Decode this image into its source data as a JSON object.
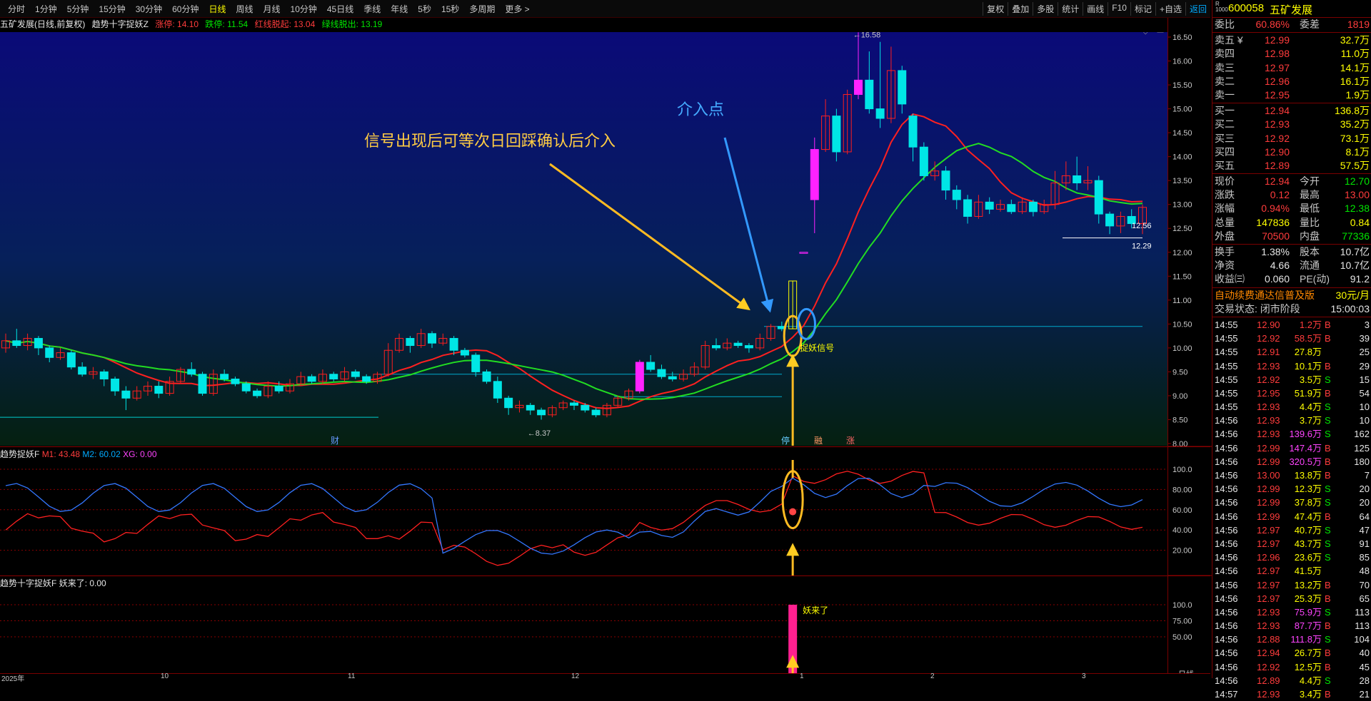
{
  "toolbar": {
    "periods": [
      "分时",
      "1分钟",
      "5分钟",
      "15分钟",
      "30分钟",
      "60分钟",
      "日线",
      "周线",
      "月线",
      "10分钟",
      "45日线",
      "季线",
      "年线",
      "5秒",
      "15秒",
      "多周期",
      "更多 >"
    ],
    "active_period": "日线",
    "right_tools": [
      "复权",
      "叠加",
      "多股",
      "统计",
      "画线",
      "F10",
      "标记",
      "+自选",
      "返回"
    ]
  },
  "main_header": {
    "stock": "五矿发展(日线,前复权)",
    "indicator": "趋势十字捉妖Z",
    "zt_label": "涨停: 14.10",
    "dt_label": "跌停: 11.54",
    "red_label": "红线脱起: 13.04",
    "green_label": "绿线脱出: 13.19"
  },
  "annotations": {
    "text1": "信号出现后可等次日回踩确认后介入",
    "text2": "介入点",
    "signal_label": "捉妖信号",
    "low_label": "←8.37",
    "high_label": "←16.58",
    "price_1256": "12.56",
    "price_1229": "12.29",
    "marker_cai": "财",
    "marker_ting": "停",
    "marker_rong": "融",
    "marker_zhang": "涨",
    "yao_label": "妖来了"
  },
  "main_axis": [
    "16.50",
    "16.00",
    "15.50",
    "15.00",
    "14.50",
    "14.00",
    "13.50",
    "13.00",
    "12.50",
    "12.00",
    "11.50",
    "11.00",
    "10.50",
    "10.00",
    "9.50",
    "9.00",
    "8.50",
    "8.00"
  ],
  "pane2": {
    "name": "趋势捉妖F",
    "m1": "M1: 43.48",
    "m2": "M2: 60.02",
    "xg": "XG: 0.00",
    "axis": [
      "100.0",
      "80.00",
      "60.00",
      "40.00",
      "20.00"
    ]
  },
  "pane3": {
    "name": "趋势十字捉妖F",
    "value": "妖来了: 0.00",
    "axis": [
      "100.0",
      "75.00",
      "50.00"
    ]
  },
  "time_axis": [
    "2025年",
    "10",
    "11",
    "12",
    "1",
    "2",
    "3"
  ],
  "quote": {
    "code": "600058",
    "name": "五矿发展",
    "ratio_label": "委比",
    "ratio": "60.86%",
    "diff_label": "委差",
    "diff": "1819",
    "asks": [
      {
        "label": "卖五 ¥",
        "price": "12.99",
        "vol": "32.7万"
      },
      {
        "label": "卖四",
        "price": "12.98",
        "vol": "11.0万"
      },
      {
        "label": "卖三",
        "price": "12.97",
        "vol": "14.1万"
      },
      {
        "label": "卖二",
        "price": "12.96",
        "vol": "16.1万"
      },
      {
        "label": "卖一",
        "price": "12.95",
        "vol": "1.9万"
      }
    ],
    "bids": [
      {
        "label": "买一",
        "price": "12.94",
        "vol": "136.8万"
      },
      {
        "label": "买二",
        "price": "12.93",
        "vol": "35.2万"
      },
      {
        "label": "买三",
        "price": "12.92",
        "vol": "73.1万"
      },
      {
        "label": "买四",
        "price": "12.90",
        "vol": "8.1万"
      },
      {
        "label": "买五",
        "price": "12.89",
        "vol": "57.5万"
      }
    ],
    "stats": [
      {
        "l1": "现价",
        "v1": "12.94",
        "l2": "今开",
        "v2": "12.70",
        "c1": "red",
        "c2": "green"
      },
      {
        "l1": "涨跌",
        "v1": "0.12",
        "l2": "最高",
        "v2": "13.00",
        "c1": "red",
        "c2": "red"
      },
      {
        "l1": "涨幅",
        "v1": "0.94%",
        "l2": "最低",
        "v2": "12.38",
        "c1": "red",
        "c2": "green"
      },
      {
        "l1": "总量",
        "v1": "147836",
        "l2": "量比",
        "v2": "0.84",
        "c1": "yellow",
        "c2": "yellow"
      },
      {
        "l1": "外盘",
        "v1": "70500",
        "l2": "内盘",
        "v2": "77336",
        "c1": "red",
        "c2": "green"
      }
    ],
    "stats2": [
      {
        "l1": "换手",
        "v1": "1.38%",
        "l2": "股本",
        "v2": "10.7亿"
      },
      {
        "l1": "净资",
        "v1": "4.66",
        "l2": "流通",
        "v2": "10.7亿"
      },
      {
        "l1": "收益㈢",
        "v1": "0.060",
        "l2": "PE(动)",
        "v2": "91.2"
      }
    ],
    "promo": "自动续费通达信普及版",
    "promo_price": "30元/月",
    "status_label": "交易状态: 闭市阶段",
    "status_time": "15:00:03",
    "ticks": [
      [
        "14:55",
        "12.90",
        "1.2万",
        "B",
        "3",
        "red",
        "red"
      ],
      [
        "14:55",
        "12.92",
        "58.5万",
        "B",
        "39",
        "red",
        "red"
      ],
      [
        "14:55",
        "12.91",
        "27.8万",
        "",
        "25",
        "red",
        "yellow"
      ],
      [
        "14:55",
        "12.93",
        "10.1万",
        "B",
        "29",
        "red",
        "yellow"
      ],
      [
        "14:55",
        "12.92",
        "3.5万",
        "S",
        "15",
        "red",
        "yellow"
      ],
      [
        "14:55",
        "12.95",
        "51.9万",
        "B",
        "54",
        "red",
        "yellow"
      ],
      [
        "14:55",
        "12.93",
        "4.4万",
        "S",
        "10",
        "red",
        "yellow"
      ],
      [
        "14:56",
        "12.93",
        "3.7万",
        "S",
        "10",
        "red",
        "yellow"
      ],
      [
        "14:56",
        "12.93",
        "139.6万",
        "S",
        "162",
        "red",
        "mag"
      ],
      [
        "14:56",
        "12.99",
        "147.4万",
        "B",
        "125",
        "red",
        "mag"
      ],
      [
        "14:56",
        "12.99",
        "320.5万",
        "B",
        "180",
        "red",
        "mag"
      ],
      [
        "14:56",
        "13.00",
        "13.8万",
        "B",
        "7",
        "red",
        "yellow"
      ],
      [
        "14:56",
        "12.99",
        "12.3万",
        "S",
        "20",
        "red",
        "yellow"
      ],
      [
        "14:56",
        "12.99",
        "37.8万",
        "S",
        "20",
        "red",
        "yellow"
      ],
      [
        "14:56",
        "12.99",
        "47.4万",
        "B",
        "64",
        "red",
        "yellow"
      ],
      [
        "14:56",
        "12.97",
        "40.7万",
        "S",
        "47",
        "red",
        "yellow"
      ],
      [
        "14:56",
        "12.97",
        "43.7万",
        "S",
        "91",
        "red",
        "yellow"
      ],
      [
        "14:56",
        "12.96",
        "23.6万",
        "S",
        "85",
        "red",
        "yellow"
      ],
      [
        "14:56",
        "12.97",
        "41.5万",
        "",
        "48",
        "red",
        "yellow"
      ],
      [
        "14:56",
        "12.97",
        "13.2万",
        "B",
        "70",
        "red",
        "yellow"
      ],
      [
        "14:56",
        "12.97",
        "25.3万",
        "B",
        "65",
        "red",
        "yellow"
      ],
      [
        "14:56",
        "12.93",
        "75.9万",
        "S",
        "113",
        "red",
        "mag"
      ],
      [
        "14:56",
        "12.93",
        "87.7万",
        "B",
        "113",
        "red",
        "mag"
      ],
      [
        "14:56",
        "12.88",
        "111.8万",
        "S",
        "104",
        "red",
        "mag"
      ],
      [
        "14:56",
        "12.94",
        "26.7万",
        "B",
        "40",
        "red",
        "yellow"
      ],
      [
        "14:56",
        "12.92",
        "12.5万",
        "B",
        "45",
        "red",
        "yellow"
      ],
      [
        "14:56",
        "12.89",
        "4.4万",
        "S",
        "28",
        "red",
        "yellow"
      ],
      [
        "14:57",
        "12.93",
        "3.4万",
        "B",
        "21",
        "red",
        "yellow"
      ]
    ],
    "footer_label": "日线"
  }
}
